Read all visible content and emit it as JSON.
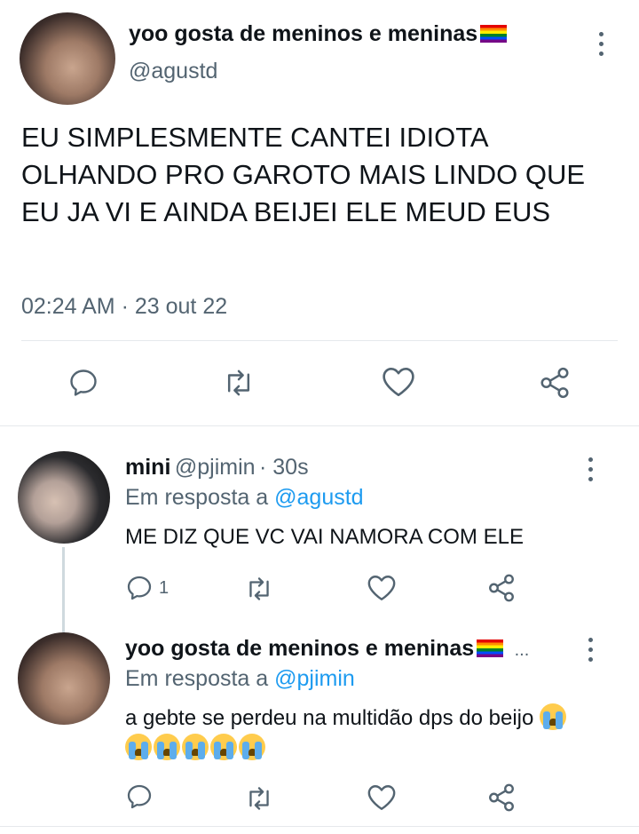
{
  "main_tweet": {
    "author_name": "yoo gosta de meninos e meninas",
    "author_handle": "@agustd",
    "text": "EU SIMPLESMENTE CANTEI IDIOTA OLHANDO PRO GAROTO MAIS LINDO QUE EU JA VI E AINDA BEIJEI ELE MEUD EUS",
    "time": "02:24 AM",
    "separator": "·",
    "date": "23 out 22",
    "flag_icon": "rainbow-flag-icon"
  },
  "replies": [
    {
      "author_name": "mini",
      "author_handle": "@pjimin",
      "time_ago": "· 30s",
      "replying_prefix": "Em resposta a",
      "replying_to": "@agustd",
      "text": "ME DIZ QUE VC VAI NAMORA COM ELE",
      "reply_count": "1"
    },
    {
      "author_name": "yoo gosta de meninos e meninas",
      "author_handle": "...",
      "replying_prefix": "Em resposta a",
      "replying_to": "@pjimin",
      "text": "a gebte se perdeu na multidão dps do beijo",
      "emoji_icon": "loudly-crying-face-icon",
      "emoji_count": 6
    }
  ],
  "colors": {
    "text": "#0f1419",
    "secondary": "#536471",
    "link": "#1d9bf0",
    "divider": "#e6e9ec"
  }
}
